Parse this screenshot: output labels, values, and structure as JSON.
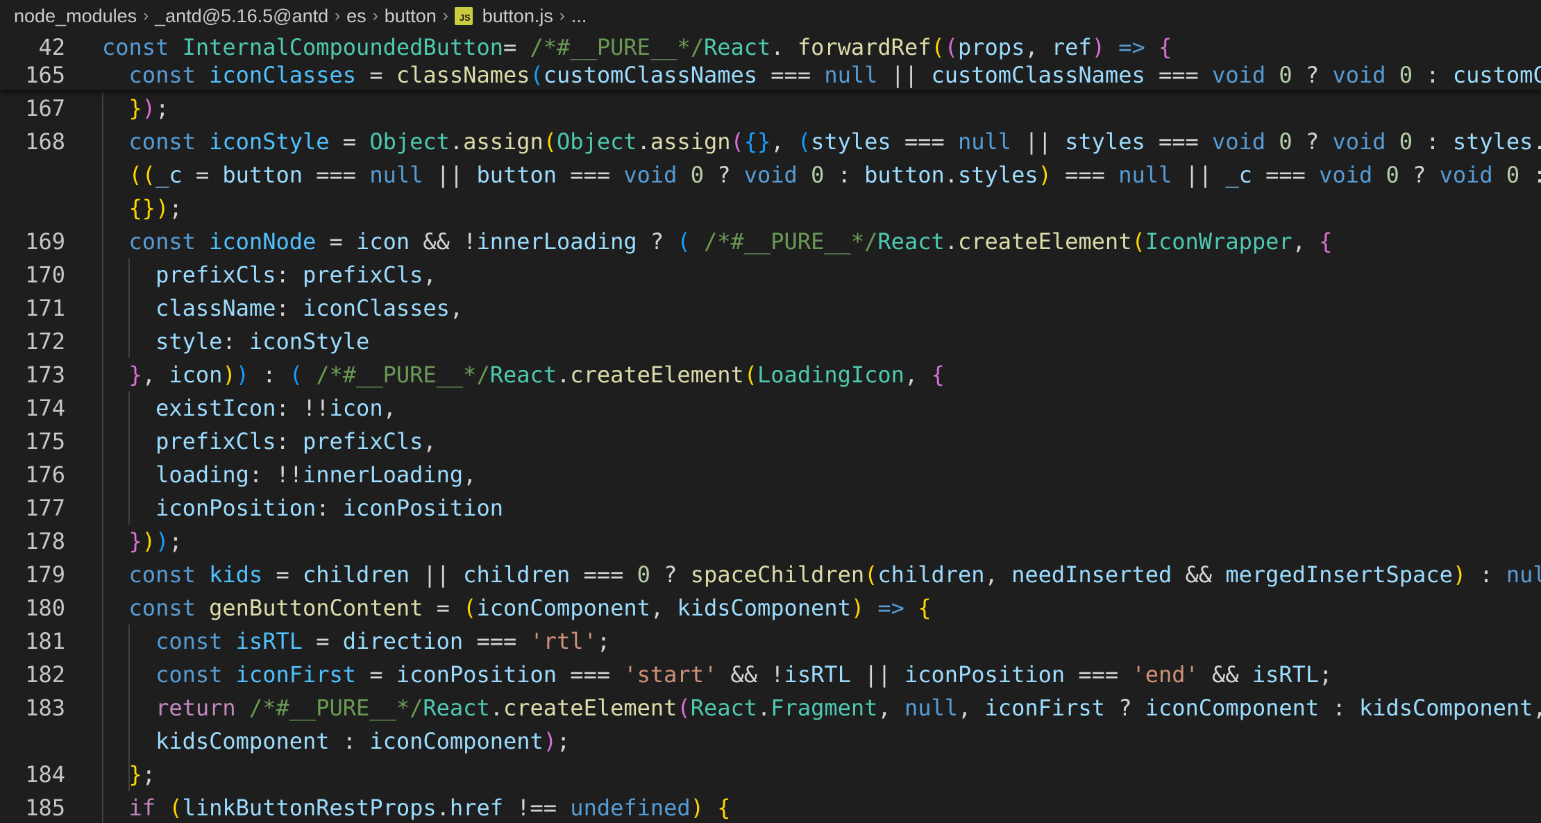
{
  "breadcrumb": {
    "items": [
      "node_modules",
      "_antd@5.16.5@antd",
      "es",
      "button",
      "button.js",
      "..."
    ],
    "file_icon_label": "JS"
  },
  "sticky_lines": [
    {
      "num": "42",
      "tokens": [
        [
          "k",
          "const "
        ],
        [
          "t",
          "InternalCompoundedButton"
        ],
        [
          "",
          "= "
        ],
        [
          "m",
          "/*#__PURE__*/"
        ],
        [
          "t",
          "React"
        ],
        [
          "",
          ". "
        ],
        [
          "f",
          "forwardRef"
        ],
        [
          "b1",
          "("
        ],
        [
          "b2",
          "("
        ],
        [
          "v",
          "props"
        ],
        [
          "",
          ", "
        ],
        [
          "v",
          "ref"
        ],
        [
          "b2",
          ")"
        ],
        [
          "k",
          " => "
        ],
        [
          "b2",
          "{"
        ]
      ]
    },
    {
      "num": "165",
      "tokens": [
        [
          "k",
          "  const "
        ],
        [
          "cst",
          "iconClasses"
        ],
        [
          "",
          " = "
        ],
        [
          "f",
          "classNames"
        ],
        [
          "b3",
          "("
        ],
        [
          "v",
          "customClassNames"
        ],
        [
          "",
          " === "
        ],
        [
          "k",
          "null"
        ],
        [
          "",
          " || "
        ],
        [
          "v",
          "customClassNames"
        ],
        [
          "",
          " === "
        ],
        [
          "k",
          "void "
        ],
        [
          "n",
          "0"
        ],
        [
          "",
          " ? "
        ],
        [
          "k",
          "void "
        ],
        [
          "n",
          "0"
        ],
        [
          "",
          " : "
        ],
        [
          "v",
          "customC"
        ]
      ]
    }
  ],
  "lines": [
    {
      "num": "167",
      "tokens": [
        [
          "",
          "  "
        ],
        [
          "b1",
          "}"
        ],
        [
          "b2",
          ")"
        ],
        [
          "",
          ";"
        ]
      ]
    },
    {
      "num": "168",
      "tokens": [
        [
          "k",
          "  const "
        ],
        [
          "cst",
          "iconStyle"
        ],
        [
          "",
          " = "
        ],
        [
          "t",
          "Object"
        ],
        [
          "",
          "."
        ],
        [
          "f",
          "assign"
        ],
        [
          "b1",
          "("
        ],
        [
          "t",
          "Object"
        ],
        [
          "",
          "."
        ],
        [
          "f",
          "assign"
        ],
        [
          "b2",
          "("
        ],
        [
          "b3",
          "{}"
        ],
        [
          "",
          ", "
        ],
        [
          "b3",
          "("
        ],
        [
          "v",
          "styles"
        ],
        [
          "",
          " === "
        ],
        [
          "k",
          "null"
        ],
        [
          "",
          " || "
        ],
        [
          "v",
          "styles"
        ],
        [
          "",
          " === "
        ],
        [
          "k",
          "void "
        ],
        [
          "n",
          "0"
        ],
        [
          "",
          " ? "
        ],
        [
          "k",
          "void "
        ],
        [
          "n",
          "0"
        ],
        [
          "",
          " : "
        ],
        [
          "v",
          "styles"
        ],
        [
          "",
          "."
        ]
      ]
    },
    {
      "num": "",
      "tokens": [
        [
          "",
          "  "
        ],
        [
          "b1",
          "(("
        ],
        [
          "v",
          "_c"
        ],
        [
          "",
          " = "
        ],
        [
          "v",
          "button"
        ],
        [
          "",
          " === "
        ],
        [
          "k",
          "null"
        ],
        [
          "",
          " || "
        ],
        [
          "v",
          "button"
        ],
        [
          "",
          " === "
        ],
        [
          "k",
          "void "
        ],
        [
          "n",
          "0"
        ],
        [
          "",
          " ? "
        ],
        [
          "k",
          "void "
        ],
        [
          "n",
          "0"
        ],
        [
          "",
          " : "
        ],
        [
          "v",
          "button"
        ],
        [
          "",
          "."
        ],
        [
          "v",
          "styles"
        ],
        [
          "b1",
          ")"
        ],
        [
          "",
          " === "
        ],
        [
          "k",
          "null"
        ],
        [
          "",
          " || "
        ],
        [
          "v",
          "_c"
        ],
        [
          "",
          " === "
        ],
        [
          "k",
          "void "
        ],
        [
          "n",
          "0"
        ],
        [
          "",
          " ? "
        ],
        [
          "k",
          "void "
        ],
        [
          "n",
          "0"
        ],
        [
          "",
          " :"
        ]
      ]
    },
    {
      "num": "",
      "tokens": [
        [
          "",
          "  "
        ],
        [
          "b1",
          "{}"
        ],
        [
          "b1",
          ")"
        ],
        [
          "",
          ";"
        ]
      ]
    },
    {
      "num": "169",
      "tokens": [
        [
          "k",
          "  const "
        ],
        [
          "cst",
          "iconNode"
        ],
        [
          "",
          " = "
        ],
        [
          "v",
          "icon"
        ],
        [
          "",
          " && !"
        ],
        [
          "v",
          "innerLoading"
        ],
        [
          "",
          " ? "
        ],
        [
          "b3",
          "( "
        ],
        [
          "m",
          "/*#__PURE__*/"
        ],
        [
          "t",
          "React"
        ],
        [
          "",
          "."
        ],
        [
          "f",
          "createElement"
        ],
        [
          "b1",
          "("
        ],
        [
          "t",
          "IconWrapper"
        ],
        [
          "",
          ", "
        ],
        [
          "b2",
          "{"
        ]
      ]
    },
    {
      "num": "170",
      "tokens": [
        [
          "",
          "    "
        ],
        [
          "v",
          "prefixCls"
        ],
        [
          "",
          ": "
        ],
        [
          "v",
          "prefixCls"
        ],
        [
          "",
          ","
        ]
      ]
    },
    {
      "num": "171",
      "tokens": [
        [
          "",
          "    "
        ],
        [
          "v",
          "className"
        ],
        [
          "",
          ": "
        ],
        [
          "v",
          "iconClasses"
        ],
        [
          "",
          ","
        ]
      ]
    },
    {
      "num": "172",
      "tokens": [
        [
          "",
          "    "
        ],
        [
          "v",
          "style"
        ],
        [
          "",
          ": "
        ],
        [
          "v",
          "iconStyle"
        ]
      ]
    },
    {
      "num": "173",
      "tokens": [
        [
          "",
          "  "
        ],
        [
          "b2",
          "}"
        ],
        [
          "",
          ", "
        ],
        [
          "v",
          "icon"
        ],
        [
          "b1",
          ")"
        ],
        [
          "b3",
          ")"
        ],
        [
          "",
          " : "
        ],
        [
          "b3",
          "( "
        ],
        [
          "m",
          "/*#__PURE__*/"
        ],
        [
          "t",
          "React"
        ],
        [
          "",
          "."
        ],
        [
          "f",
          "createElement"
        ],
        [
          "b1",
          "("
        ],
        [
          "t",
          "LoadingIcon"
        ],
        [
          "",
          ", "
        ],
        [
          "b2",
          "{"
        ]
      ]
    },
    {
      "num": "174",
      "tokens": [
        [
          "",
          "    "
        ],
        [
          "v",
          "existIcon"
        ],
        [
          "",
          ": !!"
        ],
        [
          "v",
          "icon"
        ],
        [
          "",
          ","
        ]
      ]
    },
    {
      "num": "175",
      "tokens": [
        [
          "",
          "    "
        ],
        [
          "v",
          "prefixCls"
        ],
        [
          "",
          ": "
        ],
        [
          "v",
          "prefixCls"
        ],
        [
          "",
          ","
        ]
      ]
    },
    {
      "num": "176",
      "tokens": [
        [
          "",
          "    "
        ],
        [
          "v",
          "loading"
        ],
        [
          "",
          ": !!"
        ],
        [
          "v",
          "innerLoading"
        ],
        [
          "",
          ","
        ]
      ]
    },
    {
      "num": "177",
      "tokens": [
        [
          "",
          "    "
        ],
        [
          "v",
          "iconPosition"
        ],
        [
          "",
          ": "
        ],
        [
          "v",
          "iconPosition"
        ]
      ]
    },
    {
      "num": "178",
      "tokens": [
        [
          "",
          "  "
        ],
        [
          "b2",
          "}"
        ],
        [
          "b1",
          ")"
        ],
        [
          "b3",
          ")"
        ],
        [
          "",
          ";"
        ]
      ]
    },
    {
      "num": "179",
      "tokens": [
        [
          "k",
          "  const "
        ],
        [
          "cst",
          "kids"
        ],
        [
          "",
          " = "
        ],
        [
          "v",
          "children"
        ],
        [
          "",
          " || "
        ],
        [
          "v",
          "children"
        ],
        [
          "",
          " === "
        ],
        [
          "n",
          "0"
        ],
        [
          "",
          " ? "
        ],
        [
          "f",
          "spaceChildren"
        ],
        [
          "b1",
          "("
        ],
        [
          "v",
          "children"
        ],
        [
          "",
          ", "
        ],
        [
          "v",
          "needInserted"
        ],
        [
          "",
          " && "
        ],
        [
          "v",
          "mergedInsertSpace"
        ],
        [
          "b1",
          ")"
        ],
        [
          "",
          " : "
        ],
        [
          "k",
          "nul"
        ]
      ]
    },
    {
      "num": "180",
      "tokens": [
        [
          "k",
          "  const "
        ],
        [
          "f",
          "genButtonContent"
        ],
        [
          "",
          " = "
        ],
        [
          "b1",
          "("
        ],
        [
          "v",
          "iconComponent"
        ],
        [
          "",
          ", "
        ],
        [
          "v",
          "kidsComponent"
        ],
        [
          "b1",
          ")"
        ],
        [
          "k",
          " => "
        ],
        [
          "b1",
          "{"
        ]
      ]
    },
    {
      "num": "181",
      "tokens": [
        [
          "k",
          "    const "
        ],
        [
          "cst",
          "isRTL"
        ],
        [
          "",
          " = "
        ],
        [
          "v",
          "direction"
        ],
        [
          "",
          " === "
        ],
        [
          "s",
          "'rtl'"
        ],
        [
          "",
          ";"
        ]
      ]
    },
    {
      "num": "182",
      "tokens": [
        [
          "k",
          "    const "
        ],
        [
          "cst",
          "iconFirst"
        ],
        [
          "",
          " = "
        ],
        [
          "v",
          "iconPosition"
        ],
        [
          "",
          " === "
        ],
        [
          "s",
          "'start'"
        ],
        [
          "",
          " && !"
        ],
        [
          "v",
          "isRTL"
        ],
        [
          "",
          " || "
        ],
        [
          "v",
          "iconPosition"
        ],
        [
          "",
          " === "
        ],
        [
          "s",
          "'end'"
        ],
        [
          "",
          " && "
        ],
        [
          "v",
          "isRTL"
        ],
        [
          "",
          ";"
        ]
      ]
    },
    {
      "num": "183",
      "tokens": [
        [
          "c",
          "    return "
        ],
        [
          "m",
          "/*#__PURE__*/"
        ],
        [
          "t",
          "React"
        ],
        [
          "",
          "."
        ],
        [
          "f",
          "createElement"
        ],
        [
          "b2",
          "("
        ],
        [
          "t",
          "React"
        ],
        [
          "",
          "."
        ],
        [
          "t",
          "Fragment"
        ],
        [
          "",
          ", "
        ],
        [
          "k",
          "null"
        ],
        [
          "",
          ", "
        ],
        [
          "v",
          "iconFirst"
        ],
        [
          "",
          " ? "
        ],
        [
          "v",
          "iconComponent"
        ],
        [
          "",
          " : "
        ],
        [
          "v",
          "kidsComponent"
        ],
        [
          "",
          ","
        ]
      ]
    },
    {
      "num": "",
      "tokens": [
        [
          "",
          "    "
        ],
        [
          "v",
          "kidsComponent"
        ],
        [
          "",
          " : "
        ],
        [
          "v",
          "iconComponent"
        ],
        [
          "b2",
          ")"
        ],
        [
          "",
          ";"
        ]
      ]
    },
    {
      "num": "184",
      "tokens": [
        [
          "",
          "  "
        ],
        [
          "b1",
          "}"
        ],
        [
          "",
          ";"
        ]
      ]
    },
    {
      "num": "185",
      "tokens": [
        [
          "c",
          "  if "
        ],
        [
          "b1",
          "("
        ],
        [
          "v",
          "linkButtonRestProps"
        ],
        [
          "",
          "."
        ],
        [
          "v",
          "href"
        ],
        [
          "",
          " !== "
        ],
        [
          "k",
          "undefined"
        ],
        [
          "b1",
          ")"
        ],
        [
          "",
          " "
        ],
        [
          "b1",
          "{"
        ]
      ]
    }
  ]
}
